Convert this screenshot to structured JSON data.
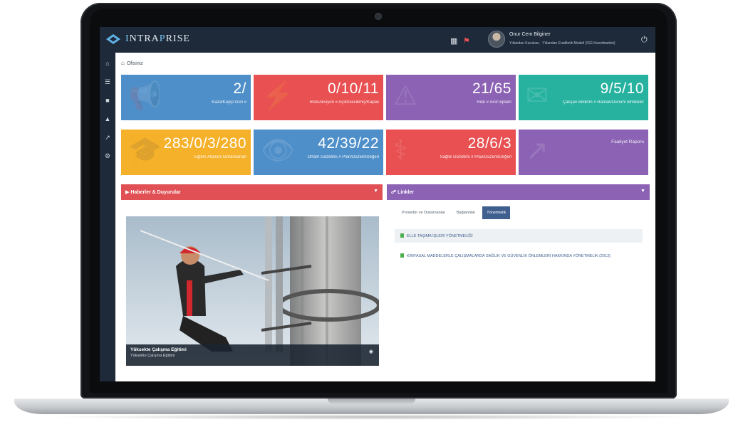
{
  "app": {
    "brand_initial": "I",
    "brand_rest": "NTRA",
    "brand_initial2": "P",
    "brand_rest2": "RISE"
  },
  "topbar": {
    "calendar_icon": "calendar-icon",
    "alert_icon": "alert-icon",
    "user_name": "Onur Cem Bilginer",
    "user_role": "Yıllandan Kurulusu · Yıllandan Eradilmik Modeli (İSG Koordinatörü)",
    "power_icon": "power-icon"
  },
  "sidebar": {
    "items": [
      {
        "icon": "home-icon"
      },
      {
        "icon": "list-icon"
      },
      {
        "icon": "book-icon"
      },
      {
        "icon": "warning-icon"
      },
      {
        "icon": "chart-icon"
      },
      {
        "icon": "settings-icon"
      }
    ]
  },
  "breadcrumb": {
    "label": "Ofisiniz"
  },
  "tiles": [
    {
      "value": "2/",
      "label": "Kaza/Kayıp Gün #",
      "color": "#4f8fc9"
    },
    {
      "value": "0/10/11",
      "label": "Risk/Aksiyon # Açık/Gecikmiş/Kapalı",
      "color": "#e85052"
    },
    {
      "value": "21/65",
      "label": "Risk # Acil/Toplam",
      "color": "#8b62b4"
    },
    {
      "value": "9/5/10",
      "label": "Çalışan Bildirim # Ramak/Durum/Tehlikeler",
      "color": "#27b2a0"
    },
    {
      "value": "283/0/3/280",
      "label": "Eğitim Atanan/Tamamlanan",
      "color": "#f6b12a"
    },
    {
      "value": "42/39/22",
      "label": "Ortam Gözetimi # Plan/Düzenl/Değerl",
      "color": "#4f8fc9"
    },
    {
      "value": "28/6/3",
      "label": "Sağlık Gözetimi # Plan/Düzenl/Değerl",
      "color": "#e85052"
    },
    {
      "value": "",
      "label": "Faaliyet Raporu",
      "color": "#8b62b4"
    }
  ],
  "panels": {
    "news_title": "Haberler & Duyurular",
    "news_color": "#e05055",
    "links_title": "Linkler",
    "links_color": "#8b62b4"
  },
  "photo": {
    "title": "Yüksekte Çalışma Eğitimi",
    "subtitle": "Yüksekte Çalışma Eğitimi"
  },
  "links": {
    "tabs": [
      "Prosedür ve Dokümanlar",
      "Bağlantılar",
      "Yönetmelik"
    ],
    "active_tab": "Yönetmelik",
    "items": [
      "ELLE TAŞIMA İŞLERİ YÖNETMELİĞİ",
      "KİMYASAL MADDELERLE ÇALIŞMALARDA SAĞLIK VE GÜVENLİK ÖNLEMLERİ HAKKINDA YÖNETMELİK (2013)"
    ]
  }
}
